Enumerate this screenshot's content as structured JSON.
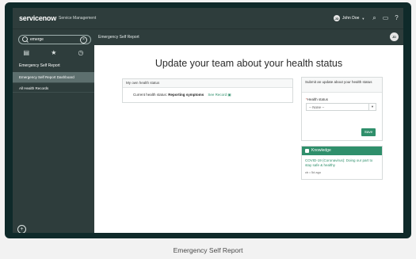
{
  "brand": {
    "logo": "servicenow",
    "product": "Service Management"
  },
  "user": {
    "name": "John Doe",
    "initials": "JD"
  },
  "top_icons": [
    "search-icon",
    "chat-icon",
    "help-icon",
    "settings-icon"
  ],
  "sidebar": {
    "search_value": "emerge",
    "nav_icons": [
      "list-icon",
      "star-icon",
      "clock-icon"
    ],
    "section_title": "Emergency Self Report",
    "items": [
      {
        "label": "Emergency Self Report Dashboard",
        "active": true
      },
      {
        "label": "All Health Records",
        "active": false
      }
    ]
  },
  "tab": {
    "title": "Emergency Self Report"
  },
  "main": {
    "headline": "Update your team about your health status",
    "own_status": {
      "header": "My own health status",
      "label": "Current health status:",
      "value": "Reporting symptoms",
      "link": "See Record"
    },
    "submit": {
      "header": "Submit an update about your health status",
      "field_label": "Health status",
      "select_value": "-- None --",
      "save": "Save"
    },
    "knowledge": {
      "header": "Knowledge",
      "article": "COVID-19 (Coronavirus): Doing our part to stay safe & healthy",
      "meta": "cb • 5d ago"
    }
  },
  "caption": "Emergency Self Report",
  "colors": {
    "frame": "#0f2a2a",
    "nav": "#2e3d3c",
    "accent": "#2f8f6b"
  }
}
